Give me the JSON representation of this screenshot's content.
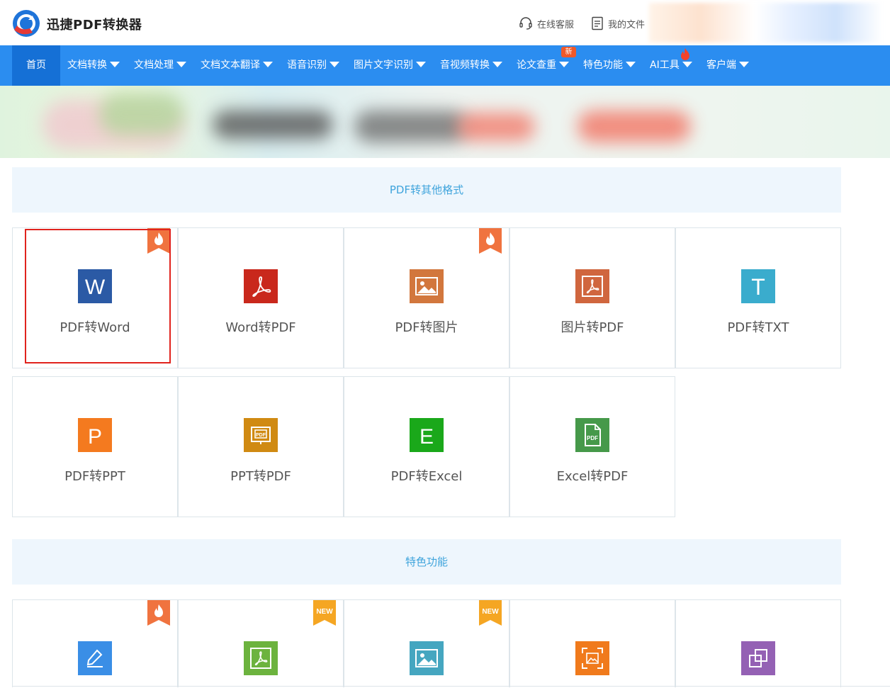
{
  "header": {
    "brand": "迅捷PDF转换器",
    "online_service": "在线客服",
    "my_files": "我的文件"
  },
  "nav": {
    "items": [
      {
        "label": "首页",
        "active": true
      },
      {
        "label": "文档转换"
      },
      {
        "label": "文档处理"
      },
      {
        "label": "文档文本翻译"
      },
      {
        "label": "语音识别"
      },
      {
        "label": "图片文字识别"
      },
      {
        "label": "音视频转换"
      },
      {
        "label": "论文查重",
        "badge": "新"
      },
      {
        "label": "特色功能"
      },
      {
        "label": "AI工具",
        "hot": true
      },
      {
        "label": "客户端"
      }
    ],
    "badge_new": "新"
  },
  "sections": {
    "pdf_to_other": "PDF转其他格式",
    "featured": "特色功能"
  },
  "tools": [
    {
      "label": "PDF转Word",
      "icon": "word-icon",
      "color": "#2b5aa5",
      "ribbon": "hot"
    },
    {
      "label": "Word转PDF",
      "icon": "acrobat-icon",
      "color": "#c9281c"
    },
    {
      "label": "PDF转图片",
      "icon": "image-icon",
      "color": "#d2773d",
      "ribbon": "hot"
    },
    {
      "label": "图片转PDF",
      "icon": "acrobat-icon",
      "color": "#d0663e"
    },
    {
      "label": "PDF转TXT",
      "icon": "text-icon",
      "color": "#3aaccd"
    },
    {
      "label": "PDF转PPT",
      "icon": "powerpoint-icon",
      "color": "#f47a1f"
    },
    {
      "label": "PPT转PDF",
      "icon": "pdf-slide-icon",
      "color": "#d08a12"
    },
    {
      "label": "PDF转Excel",
      "icon": "excel-icon",
      "color": "#1aa81a"
    },
    {
      "label": "Excel转PDF",
      "icon": "pdf-file-icon",
      "color": "#46994a"
    }
  ],
  "featured_tools": [
    {
      "icon": "edit-icon",
      "color": "#3a8ee6",
      "ribbon": "hot"
    },
    {
      "icon": "acrobat-icon",
      "color": "#6cb33e",
      "ribbon": "NEW"
    },
    {
      "icon": "image-icon",
      "color": "#45a6c0",
      "ribbon": "NEW"
    },
    {
      "icon": "scan-image-icon",
      "color": "#f07a1c"
    },
    {
      "icon": "copy-icon",
      "color": "#9461b4"
    }
  ],
  "ribbon_new": "NEW"
}
